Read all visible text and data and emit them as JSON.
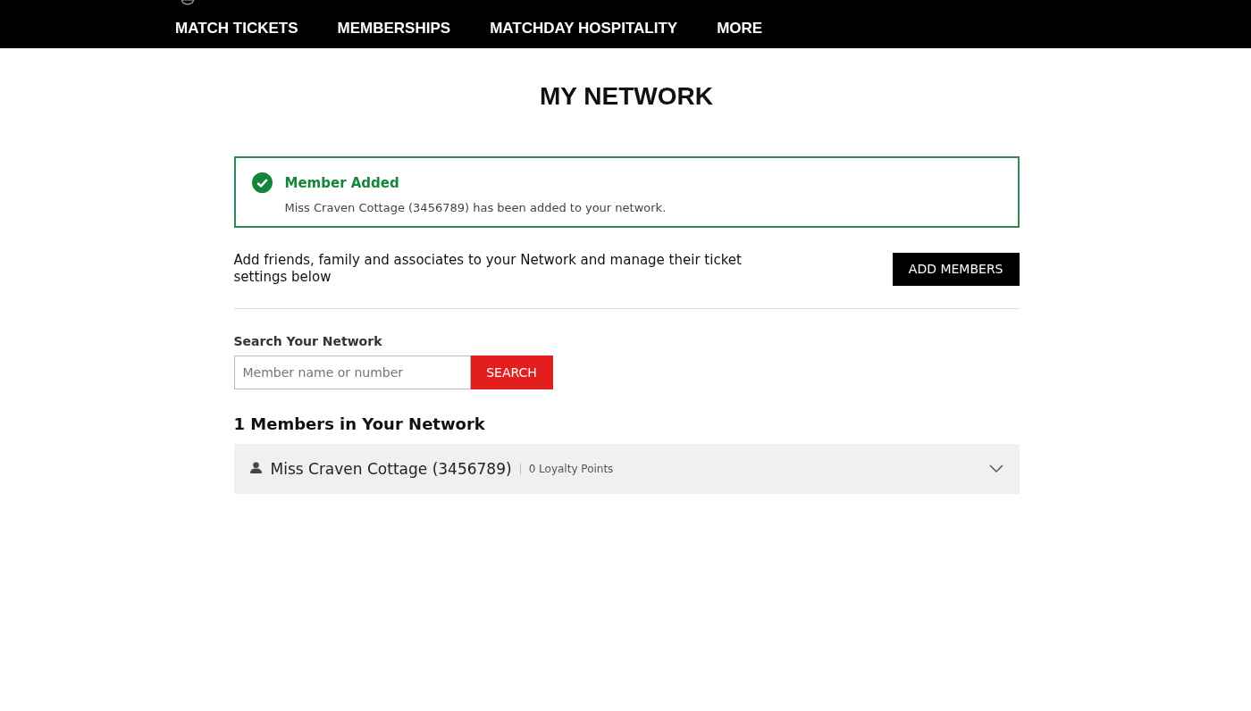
{
  "nav": {
    "items": [
      {
        "label": "MATCH TICKETS"
      },
      {
        "label": "MEMBERSHIPS"
      },
      {
        "label": "MATCHDAY HOSPITALITY"
      },
      {
        "label": "MORE"
      }
    ]
  },
  "page_title": "MY NETWORK",
  "alert": {
    "title": "Member Added",
    "message": "Miss Craven Cottage (3456789) has been added to your network."
  },
  "intro": "Add friends, family and associates to your Network and manage their ticket settings below",
  "add_button": "ADD MEMBERS",
  "search": {
    "label": "Search Your Network",
    "placeholder": "Member name or number",
    "button": "SEARCH"
  },
  "members_heading": "1 Members in Your Network",
  "members": [
    {
      "name": "Miss Craven Cottage (3456789)",
      "points": "0 Loyalty Points",
      "expanded": false
    }
  ]
}
